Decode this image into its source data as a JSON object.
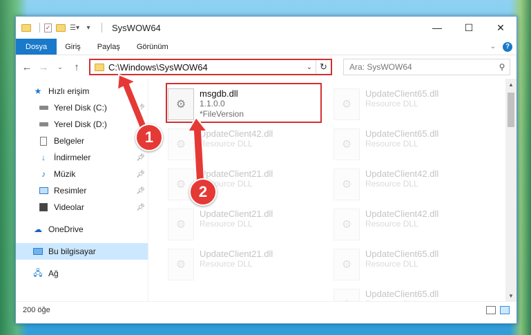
{
  "window": {
    "title": "SysWOW64",
    "controls": {
      "minimize": "—",
      "maximize": "☐",
      "close": "✕"
    }
  },
  "ribbon": {
    "tabs": [
      "Dosya",
      "Giriş",
      "Paylaş",
      "Görünüm"
    ],
    "help": "?"
  },
  "address": {
    "path": "C:\\Windows\\SysWOW64",
    "search_placeholder": "Ara: SysWOW64"
  },
  "sidebar": {
    "quick_access": "Hızlı erişim",
    "items": [
      {
        "label": "Yerel Disk (C:)",
        "icon": "drive-icon",
        "pinned": true
      },
      {
        "label": "Yerel Disk (D:)",
        "icon": "drive-icon",
        "pinned": false
      },
      {
        "label": "Belgeler",
        "icon": "documents-icon",
        "pinned": true
      },
      {
        "label": "İndirmeler",
        "icon": "download-icon",
        "pinned": true
      },
      {
        "label": "Müzik",
        "icon": "music-icon",
        "pinned": true
      },
      {
        "label": "Resimler",
        "icon": "pictures-icon",
        "pinned": true
      },
      {
        "label": "Videolar",
        "icon": "videos-icon",
        "pinned": true
      }
    ],
    "onedrive": "OneDrive",
    "this_pc": "Bu bilgisayar",
    "network": "Ağ"
  },
  "files": {
    "highlighted": {
      "name": "msgdb.dll",
      "version": "1.1.0.0",
      "description": "*FileVersion"
    },
    "background": [
      {
        "name": "UpdateClient65.dll",
        "type": "Resource DLL"
      },
      {
        "name": "UpdateClient42.dll",
        "type": "Resource DLL"
      },
      {
        "name": "UpdateClient65.dll",
        "type": "Resource DLL"
      },
      {
        "name": "UpdateClient21.dll",
        "type": "Resource DLL"
      },
      {
        "name": "UpdateClient42.dll",
        "type": "Resource DLL"
      },
      {
        "name": "UpdateClient21.dll",
        "type": "Resource DLL"
      },
      {
        "name": "UpdateClient42.dll",
        "type": "Resource DLL"
      },
      {
        "name": "UpdateClient21.dll",
        "type": "Resource DLL"
      },
      {
        "name": "UpdateClient65.dll",
        "type": "Resource DLL"
      },
      {
        "name": "UpdateClient65.dll",
        "type": "Resource DLL"
      }
    ]
  },
  "status": {
    "count": "200 öğe"
  },
  "annotations": {
    "step1": "1",
    "step2": "2"
  },
  "colors": {
    "accent": "#1979ca",
    "highlight": "#d32f2f",
    "badge": "#e53935"
  }
}
